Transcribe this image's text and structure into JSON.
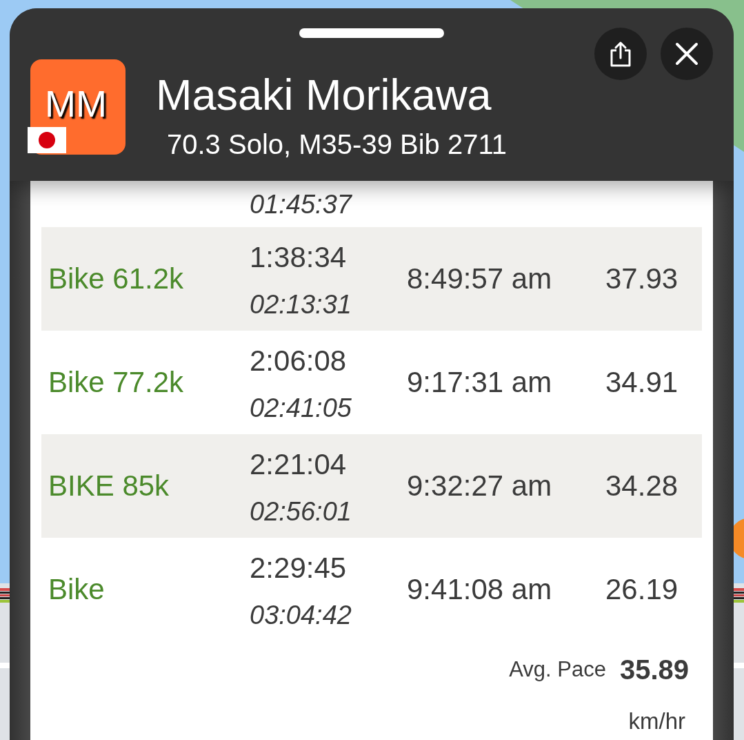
{
  "athlete": {
    "initials": "MM",
    "name": "Masaki Morikawa",
    "details": "70.3 Solo, M35-39 Bib 2711"
  },
  "splits": [
    {
      "column_2": {
        "bottom": "01:45:37"
      }
    },
    {
      "column_1": "Bike 61.2k",
      "column_2": {
        "top": "1:38:34",
        "bottom": "02:13:31"
      },
      "column_3": "8:49:57 am",
      "column_4": "37.93"
    },
    {
      "column_1": "Bike 77.2k",
      "column_2": {
        "top": "2:06:08",
        "bottom": "02:41:05"
      },
      "column_3": "9:17:31 am",
      "column_4": "34.91"
    },
    {
      "column_1": "BIKE 85k",
      "column_2": {
        "top": "2:21:04",
        "bottom": "02:56:01"
      },
      "column_3": "9:32:27 am",
      "column_4": "34.28"
    },
    {
      "column_1": "Bike",
      "column_2": {
        "top": "2:29:45",
        "bottom": "03:04:42"
      },
      "column_3": "9:41:08 am",
      "column_4": "26.19"
    }
  ],
  "summary": {
    "label": "Avg. Pace",
    "value": "35.89",
    "unit": "km/hr"
  }
}
